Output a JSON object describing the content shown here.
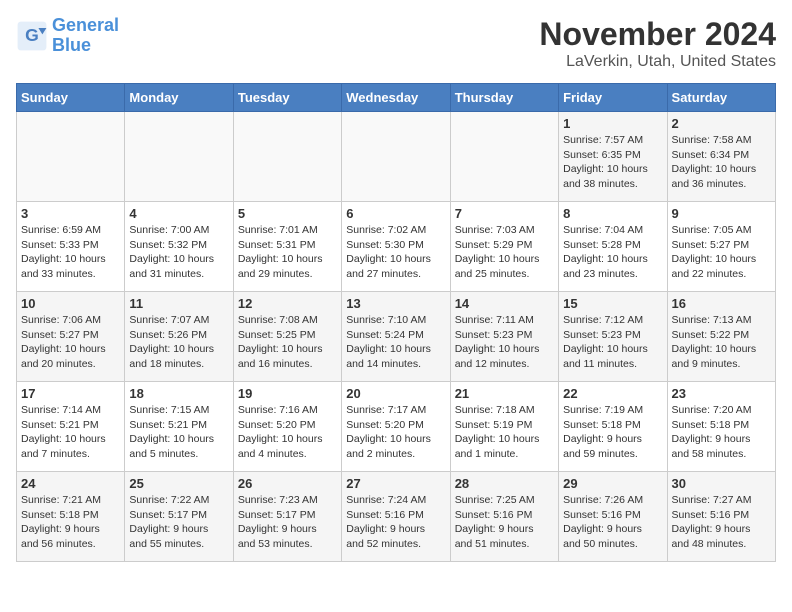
{
  "header": {
    "logo_line1": "General",
    "logo_line2": "Blue",
    "month": "November 2024",
    "location": "LaVerkin, Utah, United States"
  },
  "days_of_week": [
    "Sunday",
    "Monday",
    "Tuesday",
    "Wednesday",
    "Thursday",
    "Friday",
    "Saturday"
  ],
  "weeks": [
    [
      {
        "day": "",
        "info": ""
      },
      {
        "day": "",
        "info": ""
      },
      {
        "day": "",
        "info": ""
      },
      {
        "day": "",
        "info": ""
      },
      {
        "day": "",
        "info": ""
      },
      {
        "day": "1",
        "info": "Sunrise: 7:57 AM\nSunset: 6:35 PM\nDaylight: 10 hours\nand 38 minutes."
      },
      {
        "day": "2",
        "info": "Sunrise: 7:58 AM\nSunset: 6:34 PM\nDaylight: 10 hours\nand 36 minutes."
      }
    ],
    [
      {
        "day": "3",
        "info": "Sunrise: 6:59 AM\nSunset: 5:33 PM\nDaylight: 10 hours\nand 33 minutes."
      },
      {
        "day": "4",
        "info": "Sunrise: 7:00 AM\nSunset: 5:32 PM\nDaylight: 10 hours\nand 31 minutes."
      },
      {
        "day": "5",
        "info": "Sunrise: 7:01 AM\nSunset: 5:31 PM\nDaylight: 10 hours\nand 29 minutes."
      },
      {
        "day": "6",
        "info": "Sunrise: 7:02 AM\nSunset: 5:30 PM\nDaylight: 10 hours\nand 27 minutes."
      },
      {
        "day": "7",
        "info": "Sunrise: 7:03 AM\nSunset: 5:29 PM\nDaylight: 10 hours\nand 25 minutes."
      },
      {
        "day": "8",
        "info": "Sunrise: 7:04 AM\nSunset: 5:28 PM\nDaylight: 10 hours\nand 23 minutes."
      },
      {
        "day": "9",
        "info": "Sunrise: 7:05 AM\nSunset: 5:27 PM\nDaylight: 10 hours\nand 22 minutes."
      }
    ],
    [
      {
        "day": "10",
        "info": "Sunrise: 7:06 AM\nSunset: 5:27 PM\nDaylight: 10 hours\nand 20 minutes."
      },
      {
        "day": "11",
        "info": "Sunrise: 7:07 AM\nSunset: 5:26 PM\nDaylight: 10 hours\nand 18 minutes."
      },
      {
        "day": "12",
        "info": "Sunrise: 7:08 AM\nSunset: 5:25 PM\nDaylight: 10 hours\nand 16 minutes."
      },
      {
        "day": "13",
        "info": "Sunrise: 7:10 AM\nSunset: 5:24 PM\nDaylight: 10 hours\nand 14 minutes."
      },
      {
        "day": "14",
        "info": "Sunrise: 7:11 AM\nSunset: 5:23 PM\nDaylight: 10 hours\nand 12 minutes."
      },
      {
        "day": "15",
        "info": "Sunrise: 7:12 AM\nSunset: 5:23 PM\nDaylight: 10 hours\nand 11 minutes."
      },
      {
        "day": "16",
        "info": "Sunrise: 7:13 AM\nSunset: 5:22 PM\nDaylight: 10 hours\nand 9 minutes."
      }
    ],
    [
      {
        "day": "17",
        "info": "Sunrise: 7:14 AM\nSunset: 5:21 PM\nDaylight: 10 hours\nand 7 minutes."
      },
      {
        "day": "18",
        "info": "Sunrise: 7:15 AM\nSunset: 5:21 PM\nDaylight: 10 hours\nand 5 minutes."
      },
      {
        "day": "19",
        "info": "Sunrise: 7:16 AM\nSunset: 5:20 PM\nDaylight: 10 hours\nand 4 minutes."
      },
      {
        "day": "20",
        "info": "Sunrise: 7:17 AM\nSunset: 5:20 PM\nDaylight: 10 hours\nand 2 minutes."
      },
      {
        "day": "21",
        "info": "Sunrise: 7:18 AM\nSunset: 5:19 PM\nDaylight: 10 hours\nand 1 minute."
      },
      {
        "day": "22",
        "info": "Sunrise: 7:19 AM\nSunset: 5:18 PM\nDaylight: 9 hours\nand 59 minutes."
      },
      {
        "day": "23",
        "info": "Sunrise: 7:20 AM\nSunset: 5:18 PM\nDaylight: 9 hours\nand 58 minutes."
      }
    ],
    [
      {
        "day": "24",
        "info": "Sunrise: 7:21 AM\nSunset: 5:18 PM\nDaylight: 9 hours\nand 56 minutes."
      },
      {
        "day": "25",
        "info": "Sunrise: 7:22 AM\nSunset: 5:17 PM\nDaylight: 9 hours\nand 55 minutes."
      },
      {
        "day": "26",
        "info": "Sunrise: 7:23 AM\nSunset: 5:17 PM\nDaylight: 9 hours\nand 53 minutes."
      },
      {
        "day": "27",
        "info": "Sunrise: 7:24 AM\nSunset: 5:16 PM\nDaylight: 9 hours\nand 52 minutes."
      },
      {
        "day": "28",
        "info": "Sunrise: 7:25 AM\nSunset: 5:16 PM\nDaylight: 9 hours\nand 51 minutes."
      },
      {
        "day": "29",
        "info": "Sunrise: 7:26 AM\nSunset: 5:16 PM\nDaylight: 9 hours\nand 50 minutes."
      },
      {
        "day": "30",
        "info": "Sunrise: 7:27 AM\nSunset: 5:16 PM\nDaylight: 9 hours\nand 48 minutes."
      }
    ]
  ]
}
